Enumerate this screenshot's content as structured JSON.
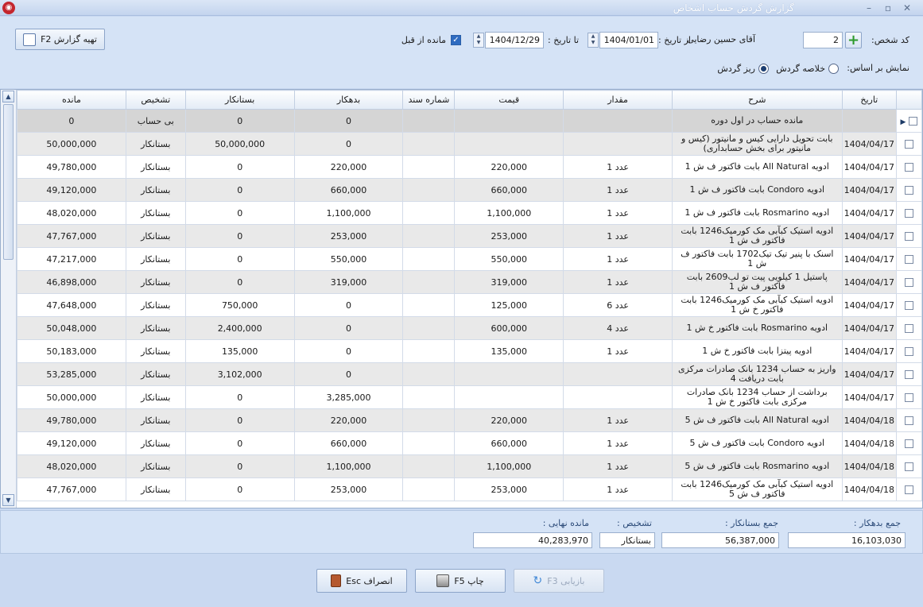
{
  "window": {
    "title": "گزارش گردش حساب اشخاص",
    "min": "–",
    "max": "▫",
    "close": "✕",
    "app_icon_glyph": "◉"
  },
  "top": {
    "person_code_label": "کد شخص:",
    "person_code": "2",
    "person_name": "آقای حسین رضایی",
    "from_date_label": "از تاریخ :",
    "from_date": "1404/01/01",
    "to_date_label": "تا تاریخ :",
    "to_date": "1404/12/29",
    "prev_balance_label": "مانده از قبل",
    "prepare_button": "تهیه گزارش F2",
    "show_based_label": "نمایش بر اساس:",
    "radio_summary": "خلاصه گردش",
    "radio_detail": "ریز گردش"
  },
  "grid": {
    "headers": {
      "date": "تاریخ",
      "desc": "شرح",
      "qty": "مقدار",
      "price": "قیمت",
      "doc": "شماره سند",
      "debit": "بدهکار",
      "credit": "بستانکار",
      "status": "تشخیص",
      "balance": "مانده"
    },
    "rows": [
      {
        "date": "",
        "desc": "مانده حساب در اول دوره",
        "qty": "",
        "price": "",
        "doc": "",
        "debit": "0",
        "credit": "0",
        "status": "بی حساب",
        "balance": "0"
      },
      {
        "date": "1404/04/17",
        "desc": "بابت تحویل دارایی کیس و مانیتور (کیس و مانیتور برای بخش حسابداری)",
        "qty": "",
        "price": "",
        "doc": "",
        "debit": "0",
        "credit": "50,000,000",
        "status": "بستانکار",
        "balance": "50,000,000"
      },
      {
        "date": "1404/04/17",
        "desc": "ادویه All Natural بابت فاکتور ف ش 1",
        "qty": "1 عدد",
        "price": "220,000",
        "doc": "",
        "debit": "220,000",
        "credit": "0",
        "status": "بستانکار",
        "balance": "49,780,000"
      },
      {
        "date": "1404/04/17",
        "desc": "ادویه Condoro بابت فاکتور ف ش 1",
        "qty": "1 عدد",
        "price": "660,000",
        "doc": "",
        "debit": "660,000",
        "credit": "0",
        "status": "بستانکار",
        "balance": "49,120,000"
      },
      {
        "date": "1404/04/17",
        "desc": "ادویه Rosmarino بابت فاکتور ف ش 1",
        "qty": "1 عدد",
        "price": "1,100,000",
        "doc": "",
        "debit": "1,100,000",
        "credit": "0",
        "status": "بستانکار",
        "balance": "48,020,000"
      },
      {
        "date": "1404/04/17",
        "desc": "ادویه استیک کبآبی مک کورمیک1246 بابت فاکتور ف ش 1",
        "qty": "1 عدد",
        "price": "253,000",
        "doc": "",
        "debit": "253,000",
        "credit": "0",
        "status": "بستانکار",
        "balance": "47,767,000"
      },
      {
        "date": "1404/04/17",
        "desc": "اسنک با پنیر تیک تیک1702 بابت فاکتور ف ش 1",
        "qty": "1 عدد",
        "price": "550,000",
        "doc": "",
        "debit": "550,000",
        "credit": "0",
        "status": "بستانکار",
        "balance": "47,217,000"
      },
      {
        "date": "1404/04/17",
        "desc": "پاستیل 1 کیلویی پیت تو لب2609 بابت فاکتور ف ش 1",
        "qty": "1 عدد",
        "price": "319,000",
        "doc": "",
        "debit": "319,000",
        "credit": "0",
        "status": "بستانکار",
        "balance": "46,898,000"
      },
      {
        "date": "1404/04/17",
        "desc": "ادویه استیک کبآبی مک کورمیک1246 بابت فاکتور خ ش 1",
        "qty": "6 عدد",
        "price": "125,000",
        "doc": "",
        "debit": "0",
        "credit": "750,000",
        "status": "بستانکار",
        "balance": "47,648,000"
      },
      {
        "date": "1404/04/17",
        "desc": "ادویه Rosmarino بابت فاکتور خ ش 1",
        "qty": "4 عدد",
        "price": "600,000",
        "doc": "",
        "debit": "0",
        "credit": "2,400,000",
        "status": "بستانکار",
        "balance": "50,048,000"
      },
      {
        "date": "1404/04/17",
        "desc": "ادویه پیتزا بابت فاکتور خ ش 1",
        "qty": "1 عدد",
        "price": "135,000",
        "doc": "",
        "debit": "0",
        "credit": "135,000",
        "status": "بستانکار",
        "balance": "50,183,000"
      },
      {
        "date": "1404/04/17",
        "desc": "واریز به حساب 1234 بانک صادرات مرکزی بابت دریافت 4",
        "qty": "",
        "price": "",
        "doc": "",
        "debit": "0",
        "credit": "3,102,000",
        "status": "بستانکار",
        "balance": "53,285,000"
      },
      {
        "date": "1404/04/17",
        "desc": "برداشت از حساب 1234 بانک صادرات مرکزی بابت فاکتور خ ش 1",
        "qty": "",
        "price": "",
        "doc": "",
        "debit": "3,285,000",
        "credit": "0",
        "status": "بستانکار",
        "balance": "50,000,000"
      },
      {
        "date": "1404/04/18",
        "desc": "ادویه All Natural بابت فاکتور ف ش 5",
        "qty": "1 عدد",
        "price": "220,000",
        "doc": "",
        "debit": "220,000",
        "credit": "0",
        "status": "بستانکار",
        "balance": "49,780,000"
      },
      {
        "date": "1404/04/18",
        "desc": "ادویه Condoro بابت فاکتور ف ش 5",
        "qty": "1 عدد",
        "price": "660,000",
        "doc": "",
        "debit": "660,000",
        "credit": "0",
        "status": "بستانکار",
        "balance": "49,120,000"
      },
      {
        "date": "1404/04/18",
        "desc": "ادویه Rosmarino بابت فاکتور ف ش 5",
        "qty": "1 عدد",
        "price": "1,100,000",
        "doc": "",
        "debit": "1,100,000",
        "credit": "0",
        "status": "بستانکار",
        "balance": "48,020,000"
      },
      {
        "date": "1404/04/18",
        "desc": "ادویه استیک کبآبی مک کورمیک1246 بابت فاکتور ف ش 5",
        "qty": "1 عدد",
        "price": "253,000",
        "doc": "",
        "debit": "253,000",
        "credit": "0",
        "status": "بستانکار",
        "balance": "47,767,000"
      }
    ]
  },
  "summary": {
    "debit_total_label": "جمع بدهکار :",
    "debit_total": "16,103,030",
    "credit_total_label": "جمع بستانکار :",
    "credit_total": "56,387,000",
    "status_label": "تشخیص :",
    "status": "بستانکار",
    "final_balance_label": "مانده نهایی :",
    "final_balance": "40,283,970"
  },
  "footer": {
    "refresh_button": "بازیابی F3",
    "print_button": "چاپ F5",
    "cancel_button": "انصراف Esc"
  }
}
